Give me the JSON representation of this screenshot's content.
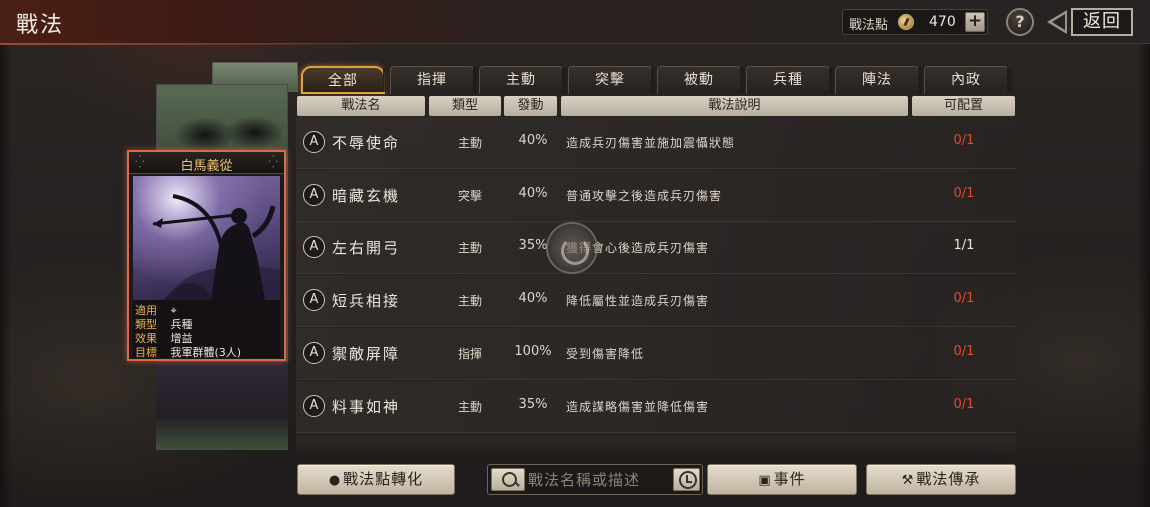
{
  "header": {
    "title": "戰法",
    "points_label": "戰法點",
    "points_value": "470",
    "add_label": "+",
    "help_label": "?",
    "back_label": "返回"
  },
  "card": {
    "title": "白馬義從",
    "info": [
      {
        "key": "適用",
        "value": "⌖"
      },
      {
        "key": "類型",
        "value": "兵種"
      },
      {
        "key": "效果",
        "value": "增益"
      },
      {
        "key": "目標",
        "value": "我軍群體(3人)"
      }
    ]
  },
  "tabs": [
    "全部",
    "指揮",
    "主動",
    "突擊",
    "被動",
    "兵種",
    "陣法",
    "內政"
  ],
  "active_tab": "全部",
  "table": {
    "headers": [
      "戰法名",
      "類型",
      "發動",
      "戰法說明",
      "可配置"
    ],
    "rows": [
      {
        "icon": "A",
        "name": "不辱使命",
        "type": "主動",
        "rate": "40%",
        "desc": "造成兵刃傷害並施加震懾狀態",
        "count": "0/1",
        "count_status": "red"
      },
      {
        "icon": "A",
        "name": "暗藏玄機",
        "type": "突擊",
        "rate": "40%",
        "desc": "普通攻擊之後造成兵刃傷害",
        "count": "0/1",
        "count_status": "red"
      },
      {
        "icon": "A",
        "name": "左右開弓",
        "type": "主動",
        "rate": "35%",
        "desc": "獲得會心後造成兵刃傷害",
        "count": "1/1",
        "count_status": "white"
      },
      {
        "icon": "A",
        "name": "短兵相接",
        "type": "主動",
        "rate": "40%",
        "desc": "降低屬性並造成兵刃傷害",
        "count": "0/1",
        "count_status": "red"
      },
      {
        "icon": "A",
        "name": "禦敵屏障",
        "type": "指揮",
        "rate": "100%",
        "desc": "受到傷害降低",
        "count": "0/1",
        "count_status": "red"
      },
      {
        "icon": "A",
        "name": "料事如神",
        "type": "主動",
        "rate": "35%",
        "desc": "造成謀略傷害並降低傷害",
        "count": "0/1",
        "count_status": "red"
      }
    ]
  },
  "bottom": {
    "convert_label": "戰法點轉化",
    "search_placeholder": "戰法名稱或描述",
    "event_label": "事件",
    "inherit_label": "戰法傳承"
  },
  "colors": {
    "accent_orange": "#e0a040",
    "count_red": "#e04a30",
    "card_border": "#d96b4a"
  }
}
